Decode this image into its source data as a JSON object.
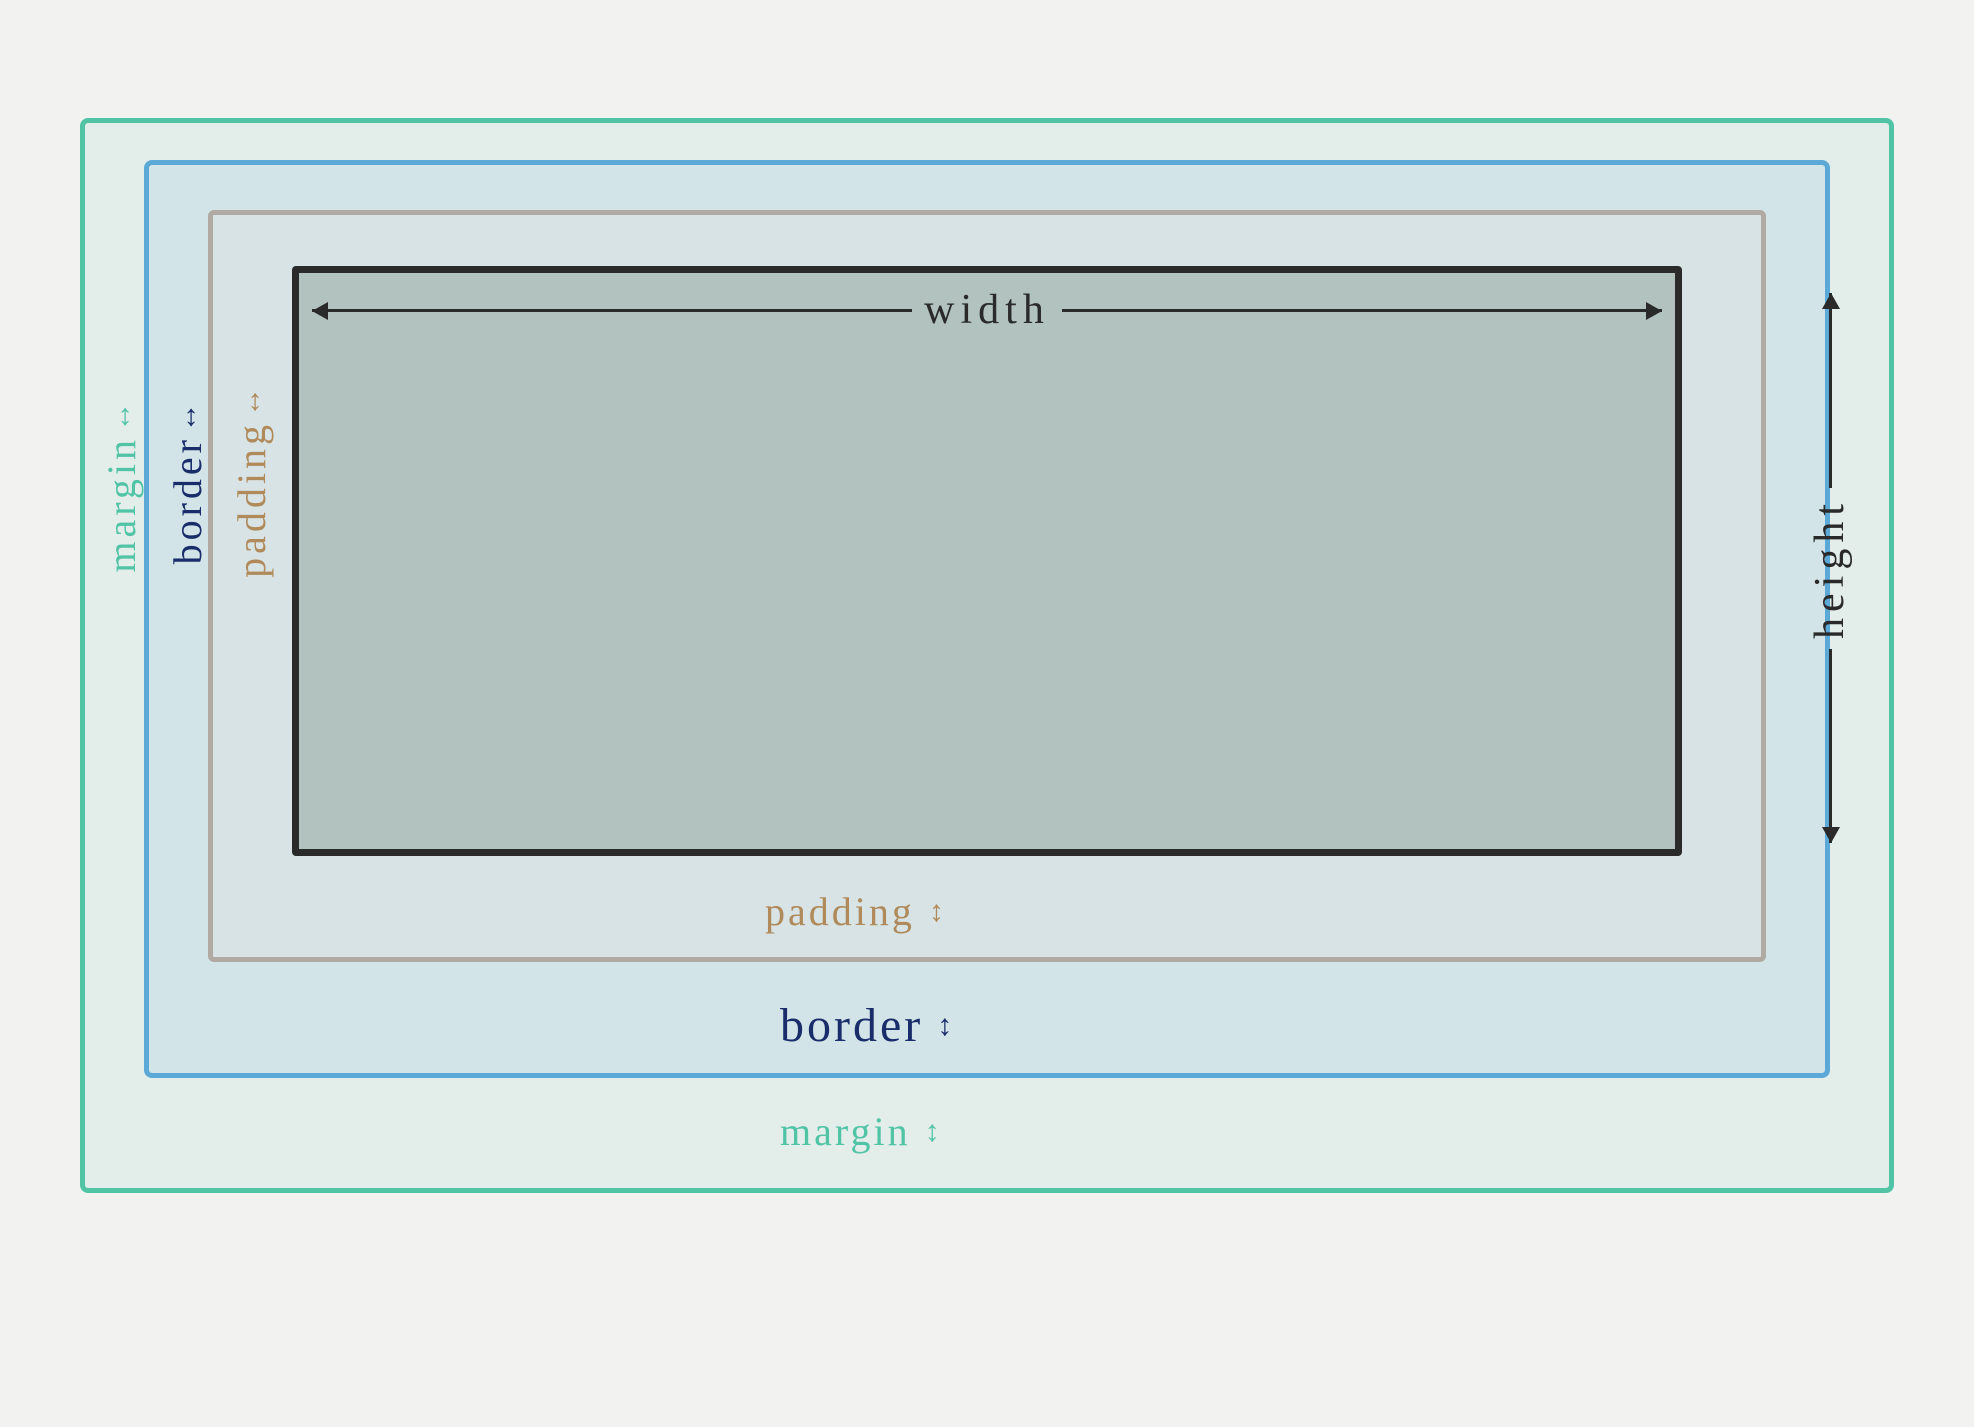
{
  "labels": {
    "margin": "margin",
    "border": "border",
    "padding": "padding",
    "width": "width",
    "height": "height"
  },
  "colors": {
    "margin_border": "#51c4a6",
    "margin_fill": "#e3ede9",
    "border_border": "#5aa9d6",
    "border_fill": "#d3e4e8",
    "padding_border": "#b0aaa2",
    "padding_fill": "#d7e3e4",
    "content_border": "#2a2a2a",
    "content_fill": "#b2c2bf",
    "margin_text": "#51c4a6",
    "border_text": "#1a2d6b",
    "padding_text": "#b08a5a"
  }
}
